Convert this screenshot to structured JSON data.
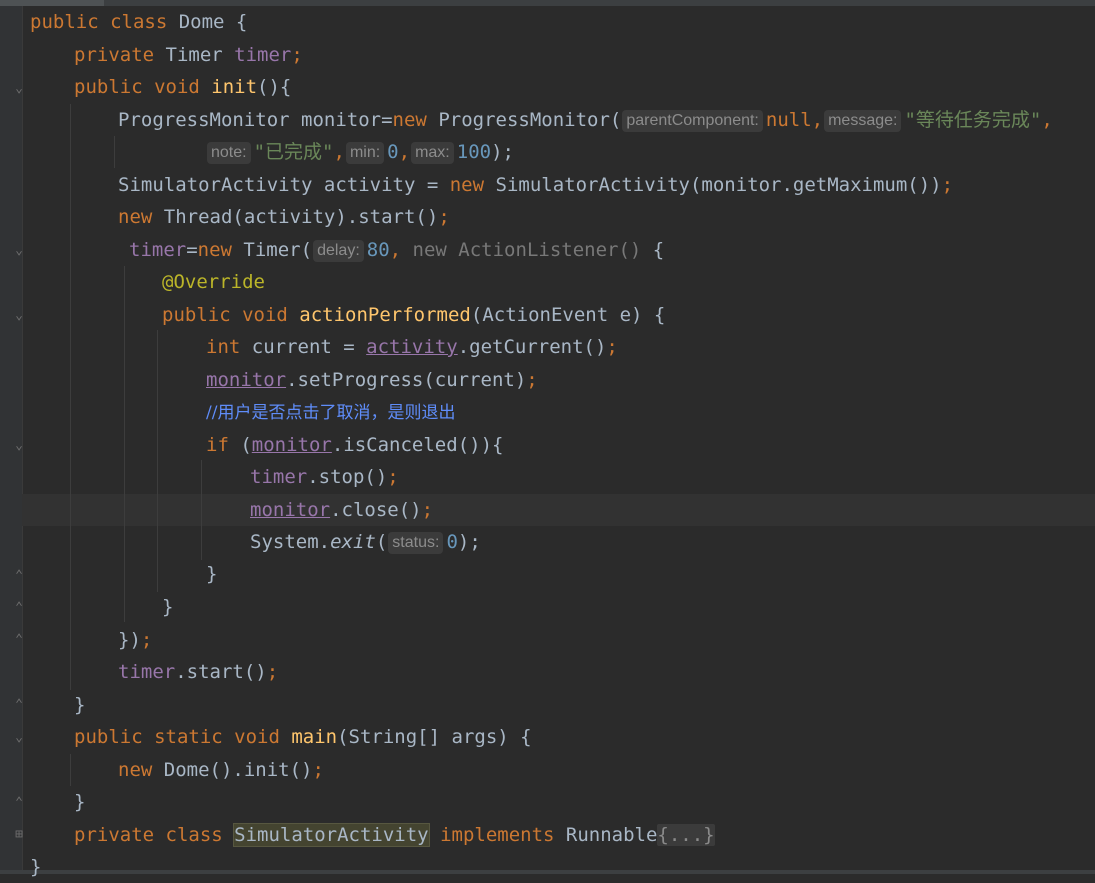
{
  "editor": {
    "lines": {
      "l1": {
        "kw1": "public class ",
        "name": "Dome",
        "brace": " {"
      },
      "l2": {
        "kw": "private ",
        "type": "Timer ",
        "field": "timer",
        "semi": ";"
      },
      "l3": {
        "kw": "public void ",
        "fn": "init",
        "rest": "(){"
      },
      "l4": {
        "t1": "ProgressMonitor monitor=",
        "kw": "new",
        "t2": " ProgressMonitor(",
        "h1": "parentComponent:",
        "v1": "null",
        "c1": ",",
        "h2": "message:",
        "s1": "\"等待任务完成\"",
        "c2": ","
      },
      "l5": {
        "h3": "note:",
        "s2": "\"已完成\"",
        "c1": ",",
        "h4": "min:",
        "n1": "0",
        "c2": ",",
        "h5": "max:",
        "n2": "100",
        "end": ");"
      },
      "l6": {
        "t1": "SimulatorActivity activity = ",
        "kw": "new",
        "t2": " SimulatorActivity(monitor.getMaximum())",
        "semi": ";"
      },
      "l7": {
        "kw": "new",
        "t1": " Thread(activity).start()",
        "semi": ";"
      },
      "l8": {
        "field": "timer",
        "t1": "=",
        "kw": "new",
        "t2": " Timer(",
        "h1": "delay:",
        "n1": "80",
        "c1": ",",
        "dim": " new ActionListener()",
        "t3": " {"
      },
      "l9": {
        "ann": "@Override"
      },
      "l10": {
        "kw": "public void ",
        "fn": "actionPerformed",
        "rest": "(ActionEvent e) {"
      },
      "l11": {
        "kw": "int",
        "t1": " current = ",
        "field": "activity",
        "t2": ".getCurrent()",
        "semi": ";"
      },
      "l12": {
        "field": "monitor",
        "t1": ".setProgress(current)",
        "semi": ";"
      },
      "l13": {
        "cmt": "//用户是否点击了取消，是则退出"
      },
      "l14": {
        "kw": "if",
        "t1": " (",
        "field": "monitor",
        "t2": ".isCanceled()){"
      },
      "l15": {
        "field": "timer",
        "t1": ".stop()",
        "semi": ";"
      },
      "l16": {
        "field": "monitor",
        "t1": ".close()",
        "semi": ";"
      },
      "l17": {
        "t1": "System.",
        "ital": "exit",
        "t2": "(",
        "h1": "status:",
        "n1": "0",
        "end": ");"
      },
      "l18": {
        "t1": "}"
      },
      "l19": {
        "t1": "}"
      },
      "l20": {
        "t1": "})",
        "semi": ";"
      },
      "l21": {
        "field": "timer",
        "t1": ".start()",
        "semi": ";"
      },
      "l22": {
        "t1": "}"
      },
      "l23": {
        "kw": "public static void ",
        "fn": "main",
        "rest": "(String[] args) {"
      },
      "l24": {
        "kw": "new",
        "t1": " Dome().init()",
        "semi": ";"
      },
      "l25": {
        "t1": "}"
      },
      "l26": {
        "kw1": "private class ",
        "cls": "SimulatorActivity",
        "kw2": " implements ",
        "t1": "Runnable",
        "fold": "{...}"
      },
      "l27": {
        "t1": "}"
      }
    }
  }
}
